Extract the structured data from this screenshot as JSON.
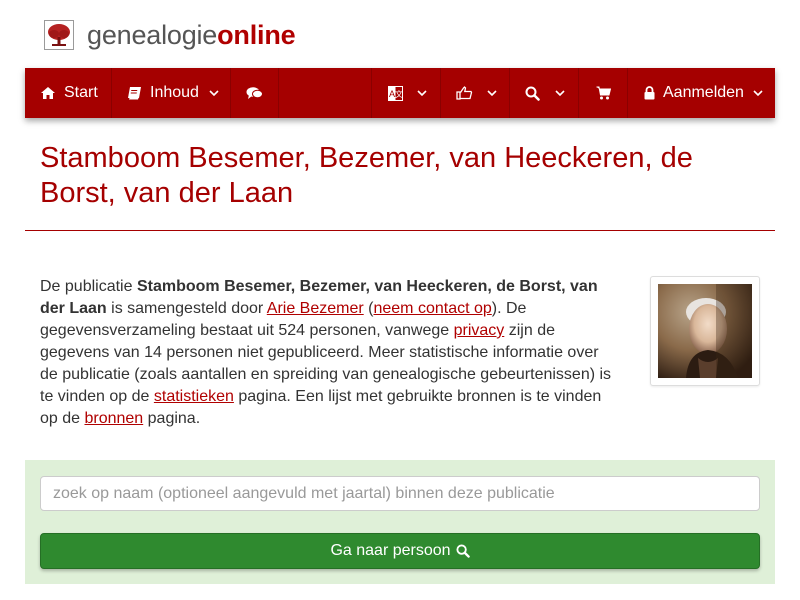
{
  "brand": {
    "part1": "genealogie",
    "part2": "online",
    "accent": "#a50000",
    "logo_icon": "tree-icon"
  },
  "nav": {
    "start": {
      "label": "Start",
      "icon": "home-icon"
    },
    "inhoud": {
      "label": "Inhoud",
      "icon": "book-icon"
    },
    "chat": {
      "icon": "comments-icon"
    },
    "language": {
      "icon": "language-icon"
    },
    "like": {
      "icon": "thumbs-up-icon"
    },
    "search": {
      "icon": "search-icon"
    },
    "cart": {
      "icon": "cart-icon"
    },
    "login": {
      "label": "Aanmelden",
      "icon": "lock-icon"
    }
  },
  "page_title": "Stamboom Besemer, Bezemer, van Heeckeren, de Borst, van der Laan",
  "intro": {
    "t1": "De publicatie ",
    "publication": "Stamboom Besemer, Bezemer, van Heeckeren, de Borst, van der Laan",
    "t2": " is samengesteld door ",
    "author": "Arie Bezemer",
    "t3": " (",
    "contact": "neem contact op",
    "t4": "). De gegevensverzameling bestaat uit 524 personen, vanwege ",
    "privacy": "privacy",
    "t5": " zijn de gegevens van 14 personen niet gepubliceerd. Meer statistische informatie over de publicatie (zoals aantallen en spreiding van genealogische gebeurtenissen) is te vinden op de ",
    "stats": "statistieken",
    "t6": " pagina. Een lijst met gebruikte bronnen is te vinden op de ",
    "sources": "bronnen",
    "t7": " pagina."
  },
  "search": {
    "placeholder": "zoek op naam (optioneel aangevuld met jaartal) binnen deze publicatie",
    "button_label": "Ga naar persoon",
    "panel_color": "#dff0d8",
    "button_color": "#2f8a2f"
  }
}
